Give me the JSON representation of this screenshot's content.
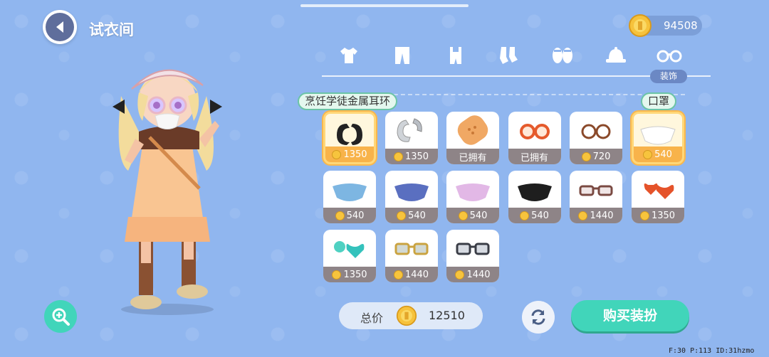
{
  "header": {
    "title": "试衣间",
    "coins": "94508"
  },
  "tabs": [
    {
      "icon": "tshirt-icon"
    },
    {
      "icon": "pants-icon"
    },
    {
      "icon": "overalls-icon"
    },
    {
      "icon": "socks-icon"
    },
    {
      "icon": "slippers-icon"
    },
    {
      "icon": "hat-icon"
    },
    {
      "icon": "glasses-icon",
      "label": "装饰",
      "selected": true
    }
  ],
  "tooltips": {
    "left": "烹饪学徒金属耳环",
    "right": "口罩"
  },
  "items": [
    {
      "icon": "black-earring-icon",
      "price": "1350",
      "selected": true
    },
    {
      "icon": "silver-earring-icon",
      "price": "1350"
    },
    {
      "icon": "bandage-icon",
      "price": "已拥有"
    },
    {
      "icon": "red-glasses-icon",
      "price": "已拥有"
    },
    {
      "icon": "round-glasses-icon",
      "price": "720"
    },
    {
      "icon": "white-mask-icon",
      "price": "540",
      "selected": true
    },
    {
      "icon": "blue-mask-icon",
      "price": "540"
    },
    {
      "icon": "navy-mask-icon",
      "price": "540"
    },
    {
      "icon": "pink-mask-icon",
      "price": "540"
    },
    {
      "icon": "black-mask-icon",
      "price": "540"
    },
    {
      "icon": "brown-glasses-icon",
      "price": "1440"
    },
    {
      "icon": "heart-earring-red-icon",
      "price": "1350"
    },
    {
      "icon": "heart-earring-teal-icon",
      "price": "1350"
    },
    {
      "icon": "gold-sunglasses-icon",
      "price": "1440"
    },
    {
      "icon": "gray-sunglasses-icon",
      "price": "1440"
    }
  ],
  "footer": {
    "total_label": "总价",
    "total_value": "12510",
    "buy_label": "购买装扮"
  },
  "debug": "F:30 P:113 ID:31hzmo"
}
